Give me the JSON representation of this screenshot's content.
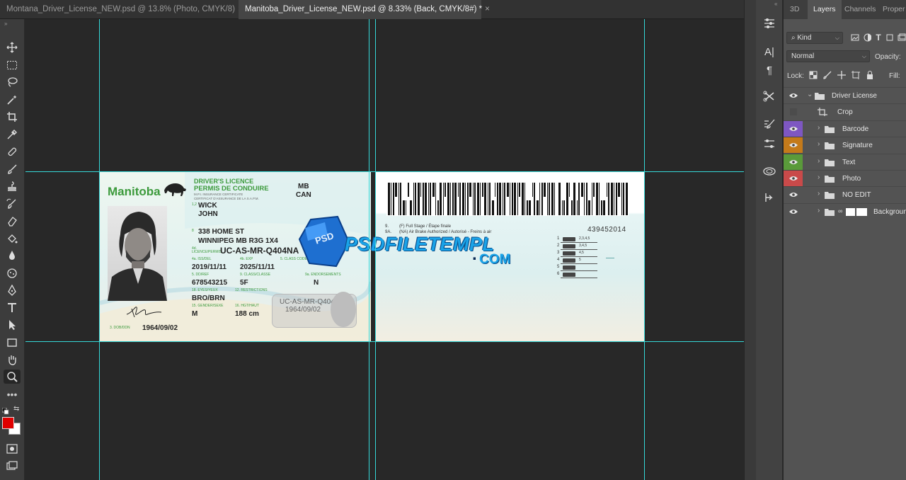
{
  "tabs": [
    {
      "label": "Montana_Driver_License_NEW.psd @ 13.8% (Photo, CMYK/8)",
      "close": "×"
    },
    {
      "label": "Manitoba_Driver_License_NEW.psd @ 8.33% (Back, CMYK/8#) *",
      "close": "×"
    }
  ],
  "panel": {
    "tabs": [
      "3D",
      "Layers",
      "Channels",
      "Proper"
    ],
    "kind_label": "Kind",
    "blend_mode": "Normal",
    "opacity_label": "Opacity:",
    "lock_label": "Lock:",
    "fill_label": "Fill:",
    "layers": [
      {
        "name": "Driver License",
        "visible": true,
        "color": ""
      },
      {
        "name": "Crop",
        "visible": false,
        "color": ""
      },
      {
        "name": "Barcode",
        "visible": true,
        "color": "#7e57c2"
      },
      {
        "name": "Signature",
        "visible": true,
        "color": "#c47a1a"
      },
      {
        "name": "Text",
        "visible": true,
        "color": "#5a9a3a"
      },
      {
        "name": "Photo",
        "visible": true,
        "color": "#c94a4a"
      },
      {
        "name": "NO EDIT",
        "visible": true,
        "color": ""
      },
      {
        "name": "Background",
        "visible": true,
        "color": ""
      }
    ]
  },
  "colors": {
    "foreground": "#e00000",
    "background": "#ffffff",
    "guide": "#35d8d8",
    "accent_green": "#3c9a3c"
  },
  "card_front": {
    "province": "Manitoba",
    "title_en": "DRIVER'S LICENCE",
    "title_fr": "PERMIS DE CONDUIRE",
    "mpi1": "M.P.I. INSURANCE CERTIFICATE",
    "mpi2": "CERTIFICAT D'ASSURANCE DE LA S.A.P.M.",
    "state": "MB",
    "country": "CAN",
    "f12": "1,2",
    "last_name": "WICK",
    "first_name": "JOHN",
    "f8": "8",
    "address1": "338 HOME ST",
    "address2": "WINNIPEG MB R3G 1X4",
    "f4d": "4d. LICENCE/PERMIS",
    "licence_no": "UC-AS-MR-Q404NA",
    "l_iss": "4a. ISS/DEL",
    "l_exp": "4b. EXP",
    "l_class": "5. CLASS CODES",
    "issue_date": "2019/11/11",
    "expiry_date": "2025/11/11",
    "l_dd": "5. DD/REF",
    "l_cls2": "9. CLASS/CLASSE",
    "l_endo": "9a. ENDORSEMENTS",
    "dd": "678543215",
    "class": "5F",
    "endorse": "N",
    "l_eyes": "18. EYES/YEUX",
    "l_restr": "12. RESTRICTIONS",
    "eyes": "BRO/BRN",
    "l_sex": "15. GENDER/SEXE",
    "l_hgt": "16. HGT/HAUT",
    "sex": "M",
    "height": "188 cm",
    "dob_label": "3. DOB/DDN",
    "dob": "1964/09/02",
    "ghost_licence": "UC-AS-MR-Q404NA",
    "ghost_dob": "1964/09/02"
  },
  "card_back": {
    "l9": "9.",
    "class_f": "(F) Full Stage / Étape finale",
    "l9a": "9A.",
    "class_na": "(NA) Air Brake Authorized / Autorisé - Freins à air",
    "number": "439452014",
    "class_rows": [
      {
        "num": "1",
        "codes": "2,3,4,5"
      },
      {
        "num": "2",
        "codes": "3,4,5"
      },
      {
        "num": "3",
        "codes": "4,5"
      },
      {
        "num": "4",
        "codes": "5"
      },
      {
        "num": "5",
        "codes": ""
      },
      {
        "num": "6",
        "codes": ""
      }
    ]
  },
  "watermark": {
    "badge": "PSD",
    "text": "PSDFILETEMPL",
    "dot": ".",
    "tld": "COM"
  }
}
